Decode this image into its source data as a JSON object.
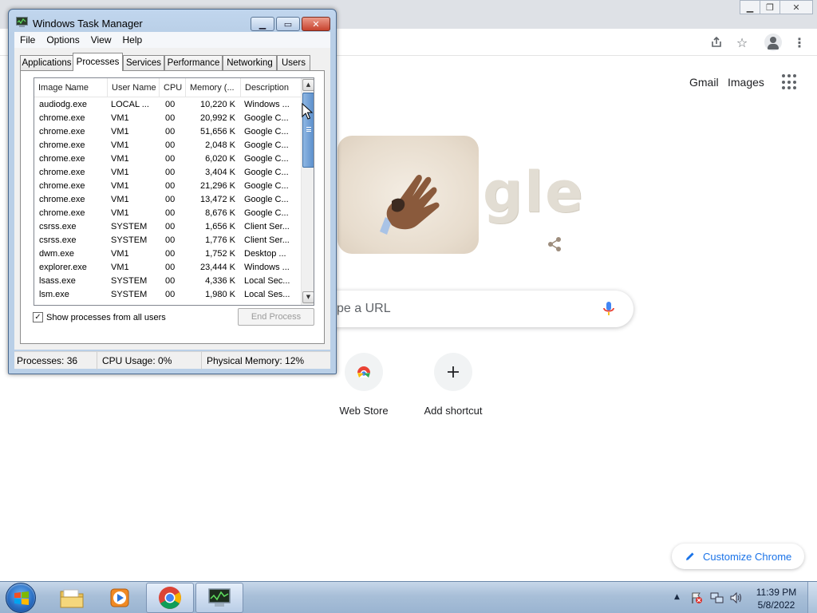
{
  "taskmgr": {
    "title": "Windows Task Manager",
    "menu": [
      "File",
      "Options",
      "View",
      "Help"
    ],
    "tabs": [
      "Applications",
      "Processes",
      "Services",
      "Performance",
      "Networking",
      "Users"
    ],
    "active_tab": "Processes",
    "columns": [
      "Image Name",
      "User Name",
      "CPU",
      "Memory (...",
      "Description"
    ],
    "processes": [
      {
        "name": "audiodg.exe",
        "user": "LOCAL ...",
        "cpu": "00",
        "mem": "10,220 K",
        "desc": "Windows ..."
      },
      {
        "name": "chrome.exe",
        "user": "VM1",
        "cpu": "00",
        "mem": "20,992 K",
        "desc": "Google C..."
      },
      {
        "name": "chrome.exe",
        "user": "VM1",
        "cpu": "00",
        "mem": "51,656 K",
        "desc": "Google C..."
      },
      {
        "name": "chrome.exe",
        "user": "VM1",
        "cpu": "00",
        "mem": "2,048 K",
        "desc": "Google C..."
      },
      {
        "name": "chrome.exe",
        "user": "VM1",
        "cpu": "00",
        "mem": "6,020 K",
        "desc": "Google C..."
      },
      {
        "name": "chrome.exe",
        "user": "VM1",
        "cpu": "00",
        "mem": "3,404 K",
        "desc": "Google C..."
      },
      {
        "name": "chrome.exe",
        "user": "VM1",
        "cpu": "00",
        "mem": "21,296 K",
        "desc": "Google C..."
      },
      {
        "name": "chrome.exe",
        "user": "VM1",
        "cpu": "00",
        "mem": "13,472 K",
        "desc": "Google C..."
      },
      {
        "name": "chrome.exe",
        "user": "VM1",
        "cpu": "00",
        "mem": "8,676 K",
        "desc": "Google C..."
      },
      {
        "name": "csrss.exe",
        "user": "SYSTEM",
        "cpu": "00",
        "mem": "1,656 K",
        "desc": "Client Ser..."
      },
      {
        "name": "csrss.exe",
        "user": "SYSTEM",
        "cpu": "00",
        "mem": "1,776 K",
        "desc": "Client Ser..."
      },
      {
        "name": "dwm.exe",
        "user": "VM1",
        "cpu": "00",
        "mem": "1,752 K",
        "desc": "Desktop ..."
      },
      {
        "name": "explorer.exe",
        "user": "VM1",
        "cpu": "00",
        "mem": "23,444 K",
        "desc": "Windows ..."
      },
      {
        "name": "lsass.exe",
        "user": "SYSTEM",
        "cpu": "00",
        "mem": "4,336 K",
        "desc": "Local Sec..."
      },
      {
        "name": "lsm.exe",
        "user": "SYSTEM",
        "cpu": "00",
        "mem": "1,980 K",
        "desc": "Local Ses..."
      }
    ],
    "show_all_label": "Show processes from all users",
    "show_all_checked": true,
    "end_process_label": "End Process",
    "status": {
      "processes": "Processes: 36",
      "cpu": "CPU Usage: 0%",
      "memory": "Physical Memory: 12%"
    }
  },
  "chrome": {
    "gmail": "Gmail",
    "images": "Images",
    "doodle_text": "gle",
    "search_placeholder": "pe a URL",
    "shortcuts": [
      {
        "label": "Web Store",
        "icon": "web-store-icon"
      },
      {
        "label": "Add shortcut",
        "icon": "plus-icon"
      }
    ],
    "customize": "Customize Chrome",
    "colors": {
      "accent": "#1a73e8",
      "mic_blue": "#4285f4",
      "mic_red": "#ea4335"
    }
  },
  "taskbar": {
    "apps": [
      "windows-explorer-icon",
      "media-player-icon",
      "chrome-icon",
      "task-manager-icon"
    ],
    "time": "11:39 PM",
    "date": "5/8/2022"
  }
}
